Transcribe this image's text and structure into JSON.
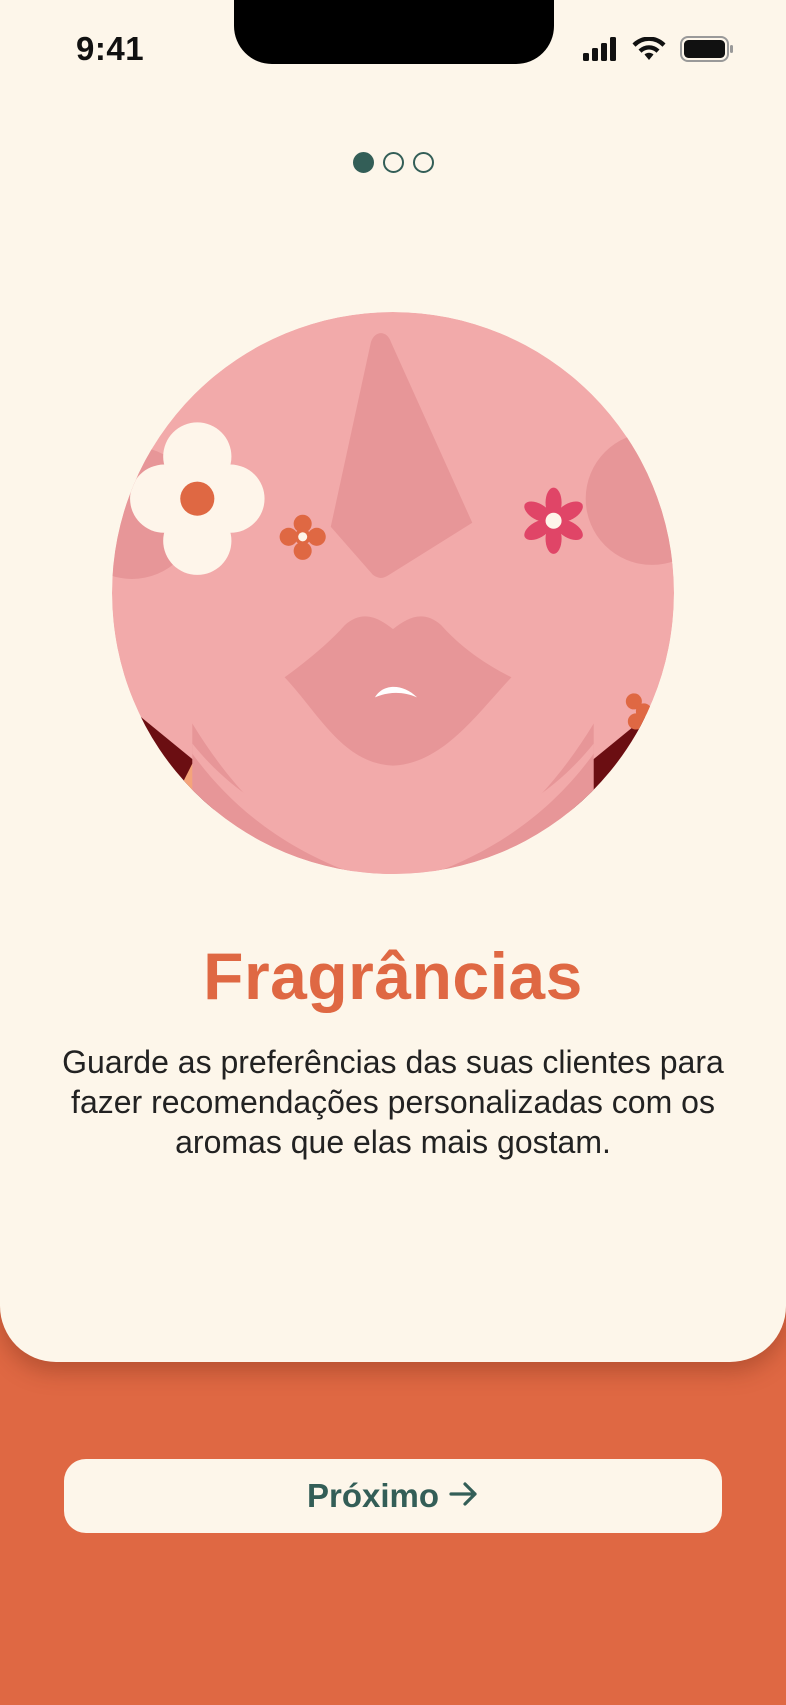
{
  "status_bar": {
    "time": "9:41",
    "icons": [
      "signal-icon",
      "wifi-icon",
      "battery-icon"
    ]
  },
  "pager": {
    "total": 3,
    "active_index": 0
  },
  "onboarding": {
    "title": "Fragrâncias",
    "description": "Guarde as preferências das suas clientes para fazer recomendações personalizadas com os aromas que elas mais gostam."
  },
  "next_button": {
    "label": "Próximo",
    "icon": "arrow-right-icon"
  },
  "colors": {
    "accent": "#DF6843",
    "background": "#FDF6EA",
    "dark_green": "#335E57",
    "face_pink": "#F2AAAA"
  }
}
